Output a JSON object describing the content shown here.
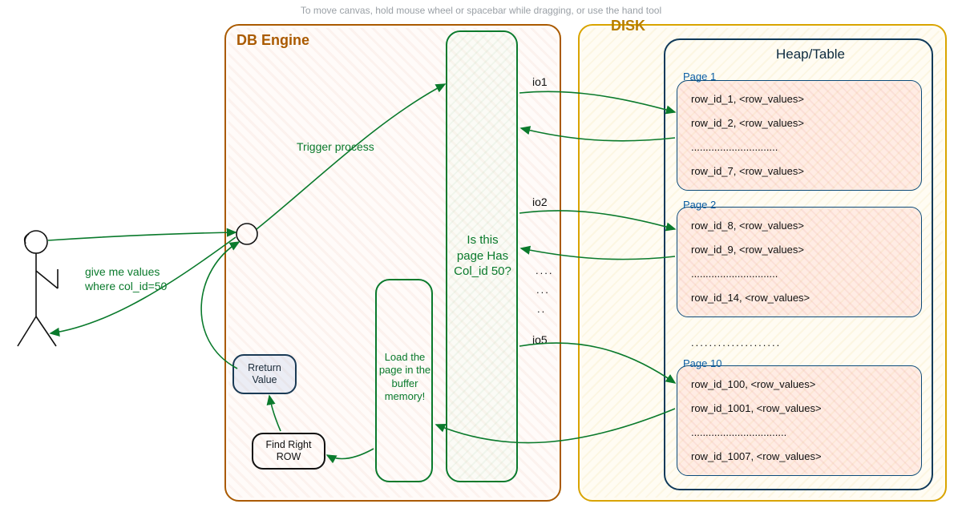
{
  "hint": "To move canvas, hold mouse wheel or spacebar while dragging, or use the hand tool",
  "db_engine": {
    "title": "DB Engine"
  },
  "disk": {
    "title": "DISK"
  },
  "heap": {
    "title": "Heap/Table",
    "pages": [
      {
        "label": "Page 1",
        "rows": [
          "row_id_1, <row_values>",
          "row_id_2, <row_values>",
          "..............................",
          "row_id_7, <row_values>"
        ]
      },
      {
        "label": "Page 2",
        "rows": [
          "row_id_8, <row_values>",
          "row_id_9, <row_values>",
          "..............................",
          "row_id_14, <row_values>"
        ]
      },
      {
        "gap": "...................."
      },
      {
        "label": "Page 10",
        "rows": [
          "row_id_100, <row_values>",
          "row_id_1001, <row_values>",
          ".................................",
          "row_id_1007, <row_values>"
        ]
      }
    ]
  },
  "io": {
    "labels": [
      "io1",
      "io2",
      "io5"
    ],
    "dots": [
      "....",
      "...",
      ".."
    ]
  },
  "buffer": {
    "page_check": "Is this page Has Col_id 50?",
    "load_label": "Load the page in the buffer memory!"
  },
  "actor": {
    "query": "give me values where col_id=50",
    "trigger": "Trigger process"
  },
  "return_box": "Rreturn Value",
  "find_row_box": "Find Right ROW"
}
